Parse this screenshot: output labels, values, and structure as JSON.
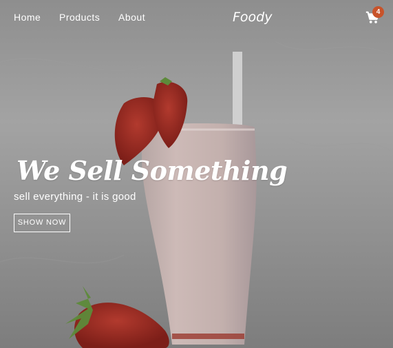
{
  "nav": {
    "links": [
      "Home",
      "Products",
      "About"
    ],
    "brand": "Foody",
    "cart_count": "4"
  },
  "hero": {
    "title": "We Sell Something",
    "subtitle": "sell everything - it is good",
    "cta_label": "SHOW NOW",
    "image": "strawberry-milkshake-photo"
  },
  "icons": {
    "cart": "shopping-cart-icon"
  },
  "colors": {
    "badge": "#c8532a",
    "text": "#ffffff",
    "overlay": "#8e8e8e"
  }
}
